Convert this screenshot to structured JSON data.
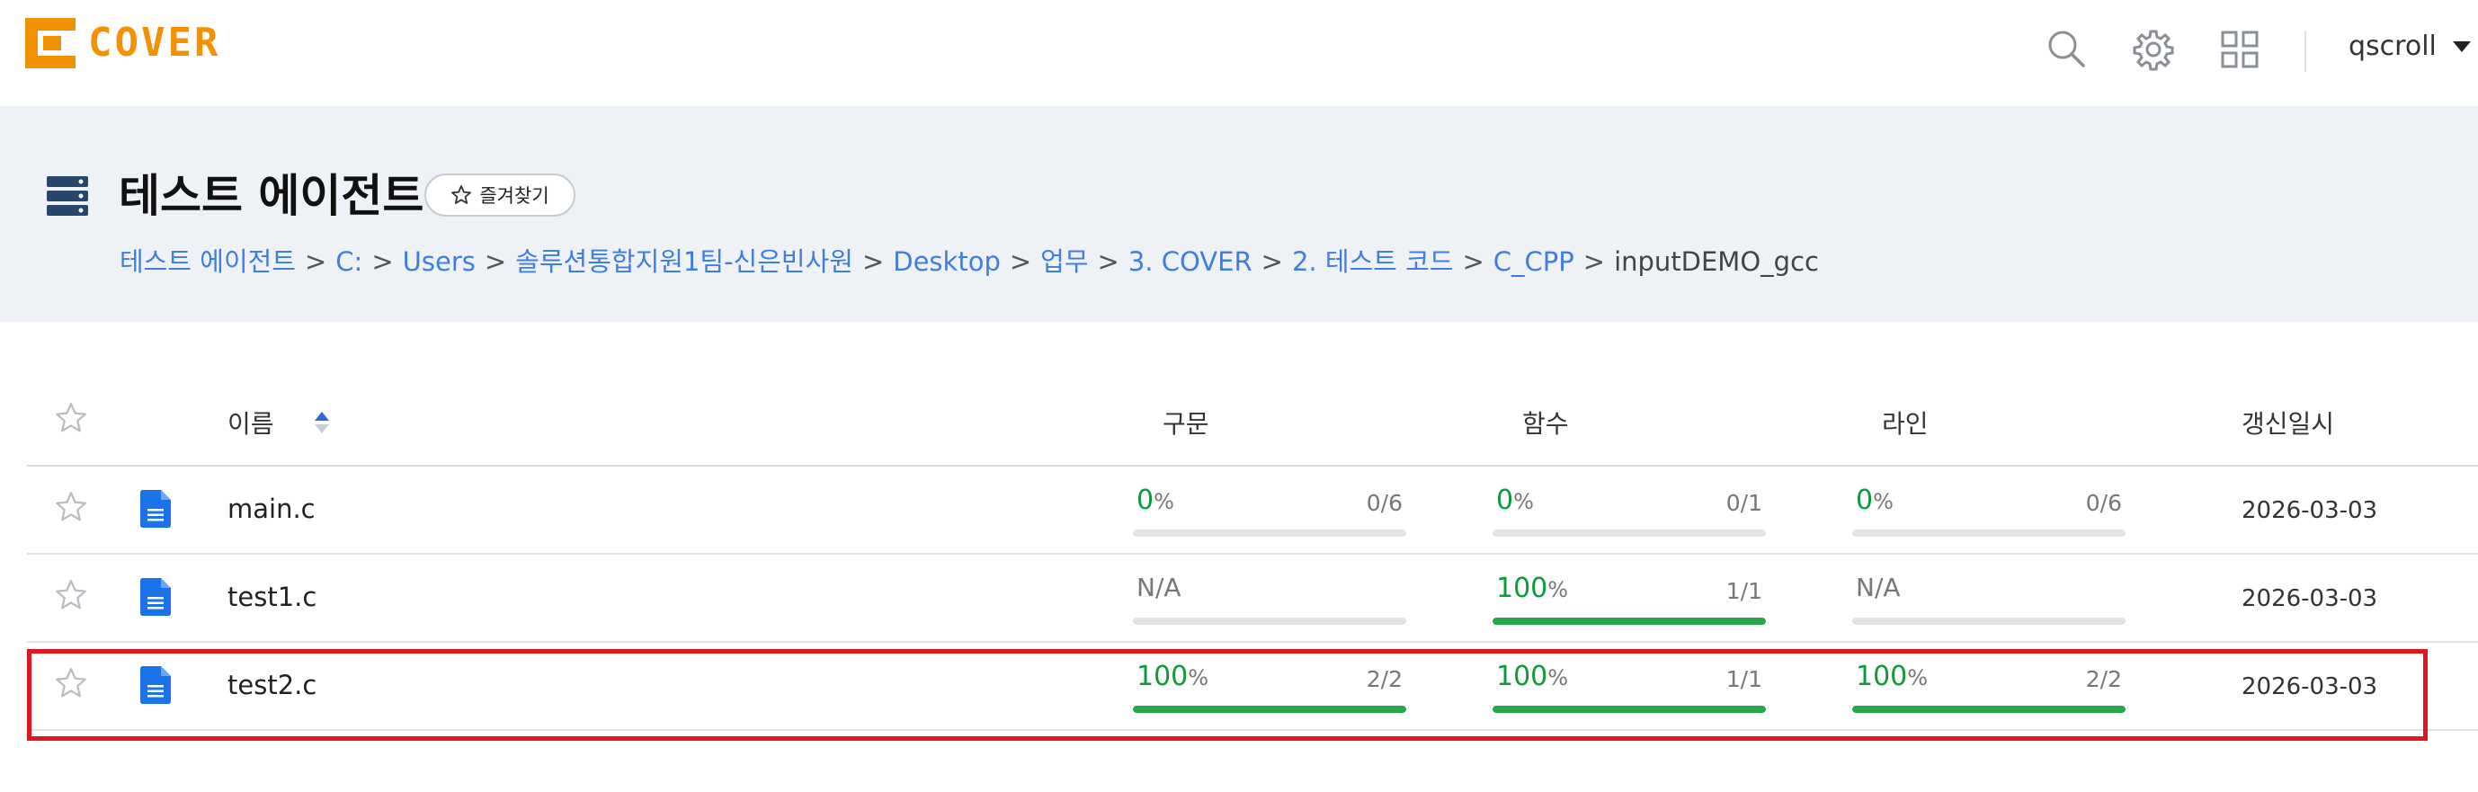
{
  "brand": {
    "logo_text": "COVER",
    "accent": "#f39200"
  },
  "header": {
    "icons": [
      "search-icon",
      "gear-icon",
      "apps-grid-icon"
    ],
    "user": "qscroll"
  },
  "title_band": {
    "title": "테스트 에이전트",
    "favorite_label": "즐겨찾기",
    "breadcrumbs": [
      "테스트 에이전트",
      "C:",
      "Users",
      "솔루션통합지원1팀-신은빈사원",
      "Desktop",
      "업무",
      "3. COVER",
      "2. 테스트 코드",
      "C_CPP"
    ],
    "current": "inputDEMO_gcc",
    "separator": ">"
  },
  "table": {
    "columns": {
      "name": "이름",
      "statement": "구문",
      "function": "함수",
      "line": "라인",
      "updated": "갱신일시"
    },
    "sort": {
      "column": "name",
      "direction": "asc"
    },
    "rows": [
      {
        "name": "main.c",
        "statement": {
          "pct": "0",
          "frac": "0/6",
          "fill": 0
        },
        "function": {
          "pct": "0",
          "frac": "0/1",
          "fill": 0
        },
        "line": {
          "pct": "0",
          "frac": "0/6",
          "fill": 0
        },
        "updated": "2026-03-03"
      },
      {
        "name": "test1.c",
        "statement": {
          "na": "N/A",
          "fill": 0
        },
        "function": {
          "pct": "100",
          "frac": "1/1",
          "fill": 100
        },
        "line": {
          "na": "N/A",
          "fill": 0
        },
        "updated": "2026-03-03"
      },
      {
        "name": "test2.c",
        "statement": {
          "pct": "100",
          "frac": "2/2",
          "fill": 100
        },
        "function": {
          "pct": "100",
          "frac": "1/1",
          "fill": 100
        },
        "line": {
          "pct": "100",
          "frac": "2/2",
          "fill": 100
        },
        "updated": "2026-03-03"
      }
    ],
    "percent_unit": "%",
    "highlighted_row": 2
  },
  "colors": {
    "link": "#3d7fe0",
    "ok_green": "#0d9a3a",
    "bar_green": "#26a849",
    "highlight": "#e0161e",
    "file_icon": "#1a73e8"
  }
}
